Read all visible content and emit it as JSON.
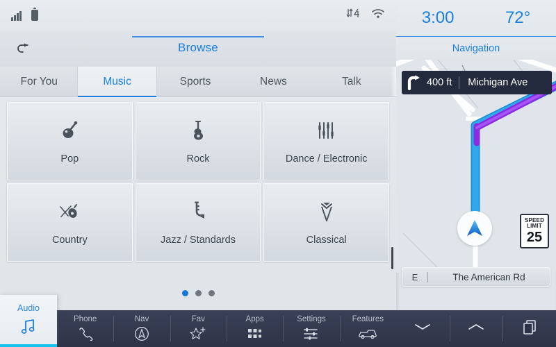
{
  "audio": {
    "statusbar": {
      "signal_icon": "signal-bars-icon",
      "battery_icon": "battery-icon",
      "data_icon": "data-transfer-4g-icon",
      "wifi_icon": "wifi-icon"
    },
    "header": {
      "back_icon": "back-arrow-icon",
      "title": "Browse"
    },
    "tabs": [
      {
        "label": "For You",
        "active": false
      },
      {
        "label": "Music",
        "active": true
      },
      {
        "label": "Sports",
        "active": false
      },
      {
        "label": "News",
        "active": false
      },
      {
        "label": "Talk",
        "active": false
      }
    ],
    "tiles": [
      {
        "label": "Pop",
        "icon": "microphone-icon"
      },
      {
        "label": "Rock",
        "icon": "electric-guitar-icon"
      },
      {
        "label": "Dance / Electronic",
        "icon": "equalizer-sliders-icon"
      },
      {
        "label": "Country",
        "icon": "banjo-fiddle-icon"
      },
      {
        "label": "Jazz / Standards",
        "icon": "saxophone-icon"
      },
      {
        "label": "Classical",
        "icon": "tuxedo-bowtie-icon"
      }
    ],
    "pager": {
      "total": 3,
      "active": 1
    },
    "audio_tab": {
      "label": "Audio",
      "icon": "music-note-icon"
    },
    "bottom_nav": [
      {
        "label": "Phone",
        "icon": "phone-handset-icon"
      },
      {
        "label": "Nav",
        "icon": "compass-circle-icon"
      },
      {
        "label": "Fav",
        "icon": "star-plus-icon"
      },
      {
        "label": "Apps",
        "icon": "apps-grid-icon"
      },
      {
        "label": "Settings",
        "icon": "sliders-icon"
      },
      {
        "label": "Features",
        "icon": "vehicle-truck-icon"
      }
    ]
  },
  "nav": {
    "clock": "3:00",
    "temperature": "72°",
    "title": "Navigation",
    "turn": {
      "icon": "turn-right-arrow-icon",
      "distance": "400 ft",
      "street": "Michigan Ave"
    },
    "speed_limit": {
      "line1": "SPEED",
      "line2": "LIMIT",
      "value": "25"
    },
    "current_street": {
      "direction": "E",
      "name": "The American Rd"
    },
    "position_marker": "vehicle-position-arrow-icon",
    "bottom_buttons": [
      {
        "icon": "chevron-down-icon"
      },
      {
        "icon": "chevron-up-icon"
      },
      {
        "icon": "layers-cards-icon"
      }
    ]
  },
  "colors": {
    "accent_blue": "#1a7fe0",
    "route_blue": "#25a4e8",
    "route_purple": "#8a2ce2",
    "dark_navy": "#2e3348",
    "cyan_underline": "#15c2ee"
  }
}
